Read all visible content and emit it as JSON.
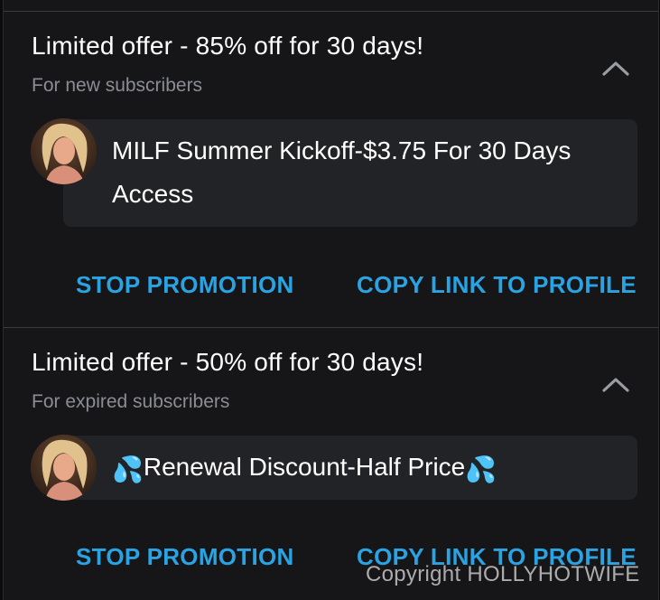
{
  "promotions": [
    {
      "title": "Limited offer - 85% off for 30 days!",
      "subtitle": "For new subscribers",
      "message": "MILF Summer Kickoff-$3.75 For 30 Days Access",
      "stop_label": "STOP PROMOTION",
      "copy_label": "COPY LINK TO PROFILE",
      "toggle_icon": "chevron-up-icon"
    },
    {
      "title": "Limited offer - 50% off for 30 days!",
      "subtitle": "For expired subscribers",
      "message_prefix_icon": "💦",
      "message": "Renewal Discount-Half Price",
      "message_suffix_icon": "💦",
      "stop_label": "STOP PROMOTION",
      "copy_label": "COPY LINK TO PROFILE",
      "toggle_icon": "chevron-up-icon"
    }
  ],
  "watermark": "Copyright HOLLYHOTWIFE",
  "colors": {
    "background": "#161618",
    "card": "#222326",
    "accent": "#2aa3e3",
    "subtitle": "#8a8d93",
    "divider": "#3a3b3e"
  }
}
